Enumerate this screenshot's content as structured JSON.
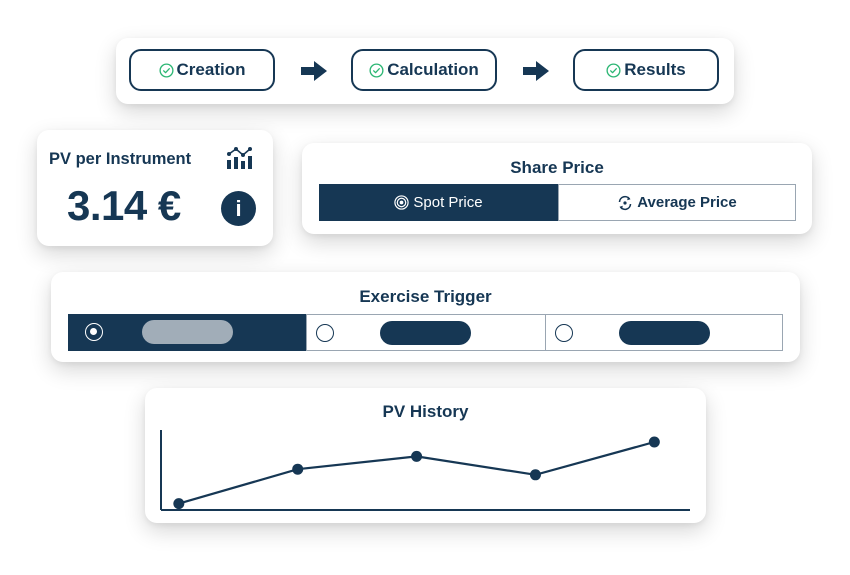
{
  "colors": {
    "primary": "#163754",
    "check_green": "#2bb673",
    "muted_pill": "#a1adb8",
    "border": "#9aa6b2"
  },
  "steps": [
    {
      "label": "Creation",
      "icon": "check-circle-icon",
      "status": "complete"
    },
    {
      "label": "Calculation",
      "icon": "check-circle-icon",
      "status": "complete"
    },
    {
      "label": "Results",
      "icon": "check-circle-icon",
      "status": "complete"
    }
  ],
  "step_separator_icon": "arrow-right-icon",
  "pv_card": {
    "title": "PV per Instrument",
    "value": "3.14 €",
    "chart_icon": "bar-line-chart-icon",
    "info_icon": "info-icon",
    "info_glyph": "i"
  },
  "share_price": {
    "title": "Share Price",
    "options": [
      {
        "label": "Spot Price",
        "icon": "target-icon",
        "selected": true
      },
      {
        "label": "Average Price",
        "icon": "refresh-icon",
        "selected": false
      }
    ]
  },
  "exercise_trigger": {
    "title": "Exercise Trigger",
    "options": [
      {
        "selected": true,
        "label_placeholder": "redacted"
      },
      {
        "selected": false,
        "label_placeholder": "redacted"
      },
      {
        "selected": false,
        "label_placeholder": "redacted"
      }
    ]
  },
  "pv_history": {
    "title": "PV History"
  },
  "chart_data": {
    "type": "line",
    "title": "PV History",
    "xlabel": "",
    "ylabel": "",
    "x": [
      1,
      2,
      3,
      4,
      5
    ],
    "series": [
      {
        "name": "PV",
        "values": [
          0.8,
          5.1,
          6.7,
          4.4,
          8.5
        ]
      }
    ],
    "ylim": [
      0,
      10
    ],
    "xlim": [
      0.85,
      5.3
    ],
    "grid": false,
    "legend": "none",
    "tick_labels": false
  }
}
